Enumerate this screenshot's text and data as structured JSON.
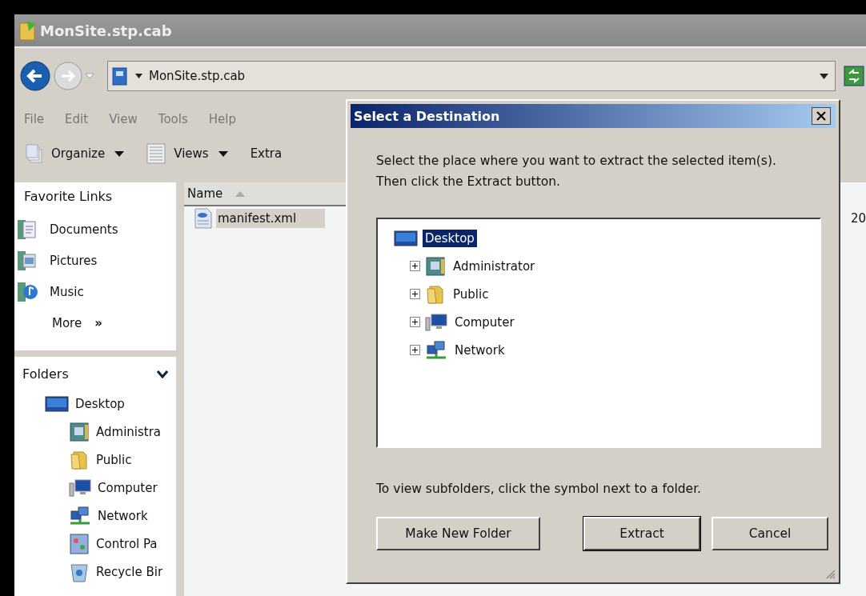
{
  "window": {
    "title": "MonSite.stp.cab"
  },
  "address_bar": {
    "path": "MonSite.stp.cab"
  },
  "menu": [
    {
      "label": "File"
    },
    {
      "label": "Edit"
    },
    {
      "label": "View"
    },
    {
      "label": "Tools"
    },
    {
      "label": "Help"
    }
  ],
  "toolbar": [
    {
      "label": "Organize",
      "kind": "organize",
      "dropdown": true
    },
    {
      "label": "Views",
      "kind": "views",
      "dropdown": true
    },
    {
      "label": "Extra",
      "kind": "extract",
      "dropdown": false
    }
  ],
  "favorite_links": {
    "title": "Favorite Links",
    "items": [
      {
        "label": "Documents",
        "kind": "documents"
      },
      {
        "label": "Pictures",
        "kind": "pictures"
      },
      {
        "label": "Music",
        "kind": "music"
      }
    ],
    "more": {
      "label": "More",
      "arrow": "»"
    }
  },
  "folders": {
    "title": "Folders",
    "items": [
      {
        "label": "Desktop",
        "kind": "desktop",
        "children": [
          {
            "label": "Administra",
            "kind": "user"
          },
          {
            "label": "Public",
            "kind": "folder"
          },
          {
            "label": "Computer",
            "kind": "computer"
          },
          {
            "label": "Network",
            "kind": "network"
          },
          {
            "label": "Control Pa",
            "kind": "control-panel"
          },
          {
            "label": "Recycle Bir",
            "kind": "recycle-bin"
          }
        ]
      }
    ]
  },
  "file_list": {
    "columns": [
      {
        "label": "Name",
        "sorted": true
      }
    ],
    "rows": [
      {
        "name": "manifest.xml",
        "column_2": "20",
        "selected": true
      }
    ]
  },
  "dialog": {
    "title": "Select a Destination",
    "instructions": "Select the place where you want to extract the selected item(s).  Then click the Extract button.",
    "tree": [
      {
        "label": "Desktop",
        "kind": "desktop",
        "selected": true,
        "children": [
          {
            "label": "Administrator",
            "kind": "user",
            "selected": false,
            "expanded": false
          },
          {
            "label": "Public",
            "kind": "folder",
            "selected": false,
            "expanded": false
          },
          {
            "label": "Computer",
            "kind": "computer",
            "selected": false,
            "expanded": false
          },
          {
            "label": "Network",
            "kind": "network",
            "selected": false,
            "expanded": false
          }
        ]
      }
    ],
    "hint": "To view subfolders, click the symbol next to a folder.",
    "buttons": [
      {
        "label": "Make New Folder",
        "default": false
      },
      {
        "label": "Extract",
        "default": true
      },
      {
        "label": "Cancel",
        "default": false
      }
    ]
  }
}
